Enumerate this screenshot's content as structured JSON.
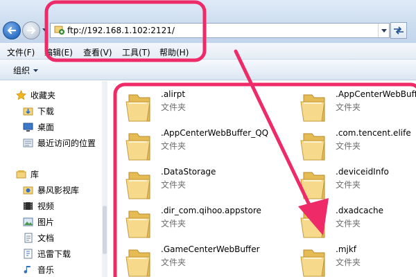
{
  "address_bar": {
    "url": "ftp://192.168.1.102:2121/"
  },
  "menu": {
    "items": [
      "文件(F)",
      "编辑(E)",
      "查看(V)",
      "工具(T)",
      "帮助(H)"
    ]
  },
  "toolbar": {
    "organize_label": "组织"
  },
  "nav": {
    "favorites_header": "收藏夹",
    "favorites": [
      {
        "label": "下载",
        "icon": "download-folder-icon"
      },
      {
        "label": "桌面",
        "icon": "desktop-icon"
      },
      {
        "label": "最近访问的位置",
        "icon": "recent-places-icon"
      }
    ],
    "libraries_header": "库",
    "libraries": [
      {
        "label": "暴风影视库",
        "icon": "video-library-icon"
      },
      {
        "label": "视频",
        "icon": "videos-icon"
      },
      {
        "label": "图片",
        "icon": "pictures-icon"
      },
      {
        "label": "文档",
        "icon": "documents-icon"
      },
      {
        "label": "迅雷下载",
        "icon": "xunlei-download-icon"
      },
      {
        "label": "音乐",
        "icon": "music-icon"
      }
    ]
  },
  "files": [
    {
      "name": ".alirpt",
      "type": "文件夹"
    },
    {
      "name": ".AppCenterWebBuffer",
      "type": "文件夹"
    },
    {
      "name": ".AppCenterWebBuffer_QQ",
      "type": "文件夹"
    },
    {
      "name": ".com.tencent.elife",
      "type": "文件夹"
    },
    {
      "name": ".DataStorage",
      "type": "文件夹"
    },
    {
      "name": ".deviceidInfo",
      "type": "文件夹"
    },
    {
      "name": ".dir_com.qihoo.appstore",
      "type": "文件夹"
    },
    {
      "name": ".dxadcache",
      "type": "文件夹"
    },
    {
      "name": ".GameCenterWebBuffer",
      "type": "文件夹"
    },
    {
      "name": ".mjkf",
      "type": "文件夹"
    }
  ],
  "colors": {
    "annotation": "#ee2a68",
    "folder": "#f3d37c"
  }
}
